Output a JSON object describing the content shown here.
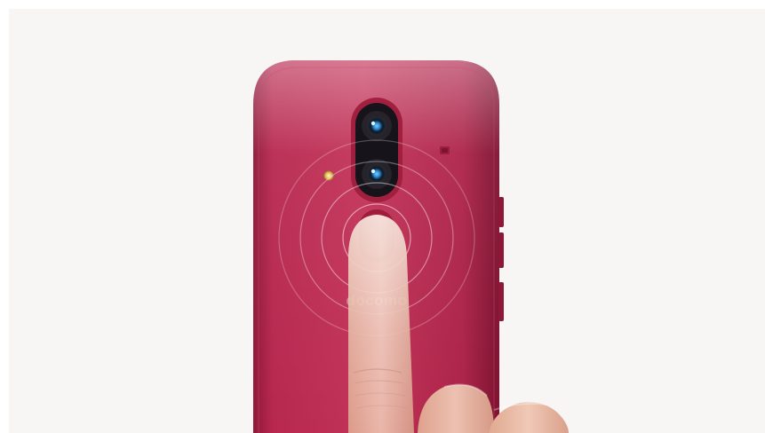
{
  "scene": {
    "subject": "phone-back-fingerprint-sensor",
    "colors": {
      "background": "#f8f5f5",
      "phone_body": "#b8284f",
      "phone_edge": "#8e1737",
      "camera_module": "#16131a",
      "lens_accent": "#2f8fd8",
      "finger_skin": "#e7bba5"
    },
    "logo": {
      "text": "docomo"
    }
  }
}
